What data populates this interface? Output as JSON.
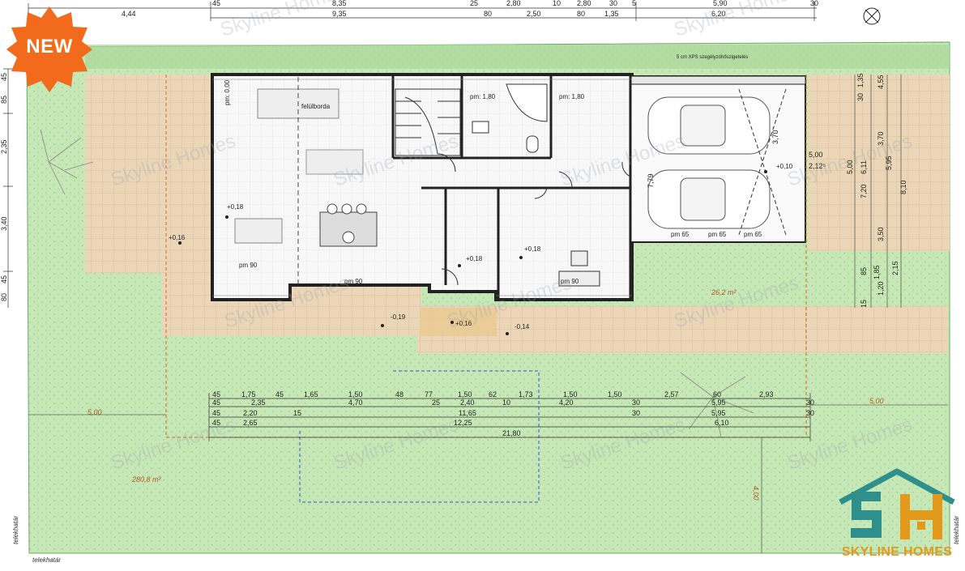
{
  "badge": {
    "label": "NEW",
    "color": "#f26a1b"
  },
  "brand": {
    "name": "SKYLINE HOMES",
    "watermark": "Skyline Homes",
    "teal": "#2f8f8c",
    "orange": "#e39a1c"
  },
  "colors": {
    "garden": "#c6e8b6",
    "paving": "#ecd6b8",
    "wall": "#222222"
  },
  "top_dims_row1": [
    "4,44",
    "45",
    "8,35",
    "25",
    "2,80",
    "10",
    "2,80",
    "30",
    "5",
    "5,90",
    "30"
  ],
  "top_dims_row2": [
    "9,35",
    "80",
    "2,50",
    "80",
    "1,35",
    "6,20"
  ],
  "rooms": {
    "pm_000": "pm: 0,00",
    "pm_180_a": "pm: 1,80",
    "pm_180_b": "pm: 1,80",
    "felulborda": "felülborda",
    "pm90_a": "pm 90",
    "pm90_b": "pm 90",
    "pm90_c": "pm 90",
    "pm65_a": "pm 65",
    "pm65_b": "pm 65",
    "pm65_c": "pm 65",
    "xps": "5 cm XPS szegélyzóhőszigetelés"
  },
  "levels": {
    "l1": "+0,18",
    "l2": "+0,18",
    "l3": "+0,18",
    "l4": "+0,16",
    "l5": "+0,16",
    "l6": "-0,19",
    "l7": "-0,14",
    "l8": "+0,10"
  },
  "areas": {
    "garden_big": "280,8 m²",
    "garden_small": "26,2 m²"
  },
  "bottom_dims_row1": [
    "45",
    "1,75",
    "45",
    "1,65",
    "1,50",
    "48",
    "77",
    "1,50",
    "62",
    "1,73",
    "1,50",
    "1,50",
    "2,57",
    "60",
    "2,93"
  ],
  "bottom_dims_row2": [
    "45",
    "2,35",
    "4,70",
    "25",
    "2,40",
    "10",
    "4,20",
    "30",
    "5,95",
    "30"
  ],
  "bottom_dims_row3": [
    "45",
    "2,20",
    "15",
    "11,65",
    "30",
    "5,95",
    "30"
  ],
  "bottom_dims_row4": [
    "45",
    "2,65",
    "12,25",
    "6,10"
  ],
  "bottom_dims_row5": [
    "21,80"
  ],
  "setbacks": {
    "left": "5,00",
    "right": "5,00",
    "bottom": "4,00"
  },
  "left_dims": [
    "85",
    "45",
    "2,35",
    "3,40",
    "45",
    "80"
  ],
  "right_dims": [
    "1,35",
    "30",
    "5,00",
    "6,11",
    "7,20",
    "3,50",
    "4,55",
    "8,10",
    "5,95",
    "3,70",
    "85",
    "1,85",
    "15",
    "1,20",
    "2,15"
  ],
  "garage_dims": {
    "w": "5,00",
    "h": "7,79",
    "inner": "2,12⁵",
    "v370": "3,70"
  },
  "telekhatar": "telekhatár"
}
